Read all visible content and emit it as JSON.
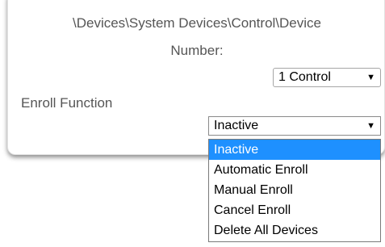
{
  "panel": {
    "path_title": "\\Devices\\System Devices\\Control\\Device",
    "device_number_label": "Number:",
    "device_select": {
      "value": "1 Control"
    },
    "enroll_label": "Enroll Function",
    "enroll_select": {
      "value": "Inactive",
      "options": [
        {
          "label": "Inactive",
          "selected": true
        },
        {
          "label": "Automatic Enroll",
          "selected": false
        },
        {
          "label": "Manual Enroll",
          "selected": false
        },
        {
          "label": "Cancel Enroll",
          "selected": false
        },
        {
          "label": "Delete All Devices",
          "selected": false
        }
      ]
    }
  },
  "colors": {
    "highlight": "#1e90ff",
    "label_text": "#555555"
  },
  "icons": {
    "dropdown_arrow": "triangle-down-icon"
  }
}
